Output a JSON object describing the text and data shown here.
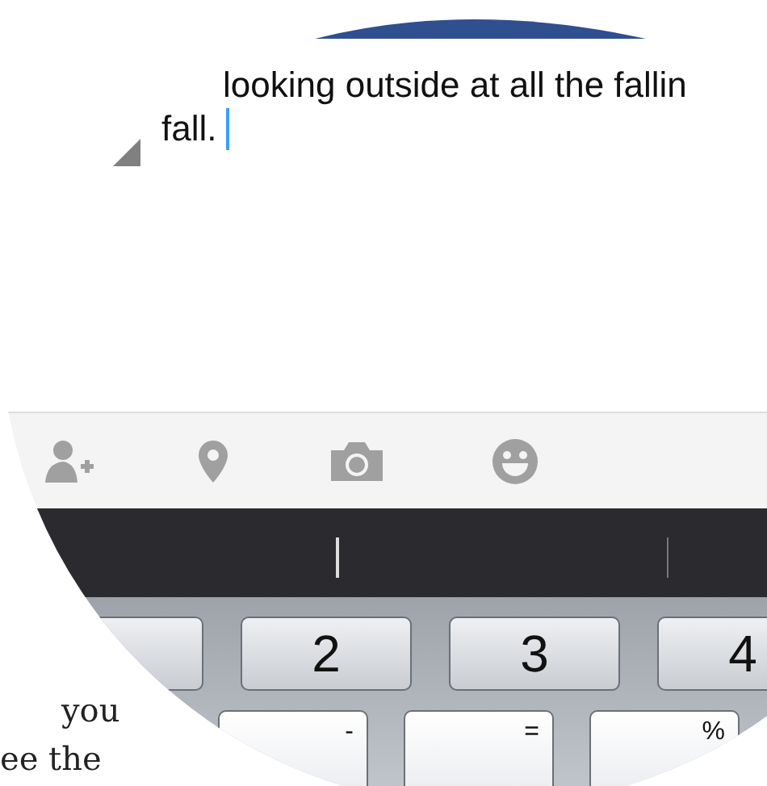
{
  "message": {
    "lines": [
      "looking outside at all the fallin",
      "fall."
    ],
    "cursor": true
  },
  "keyboard": {
    "number_keys": [
      "2",
      "3",
      "4"
    ],
    "letter_hints": [
      "-",
      "=",
      "%"
    ]
  },
  "page_text": [
    "you",
    "ee the"
  ]
}
